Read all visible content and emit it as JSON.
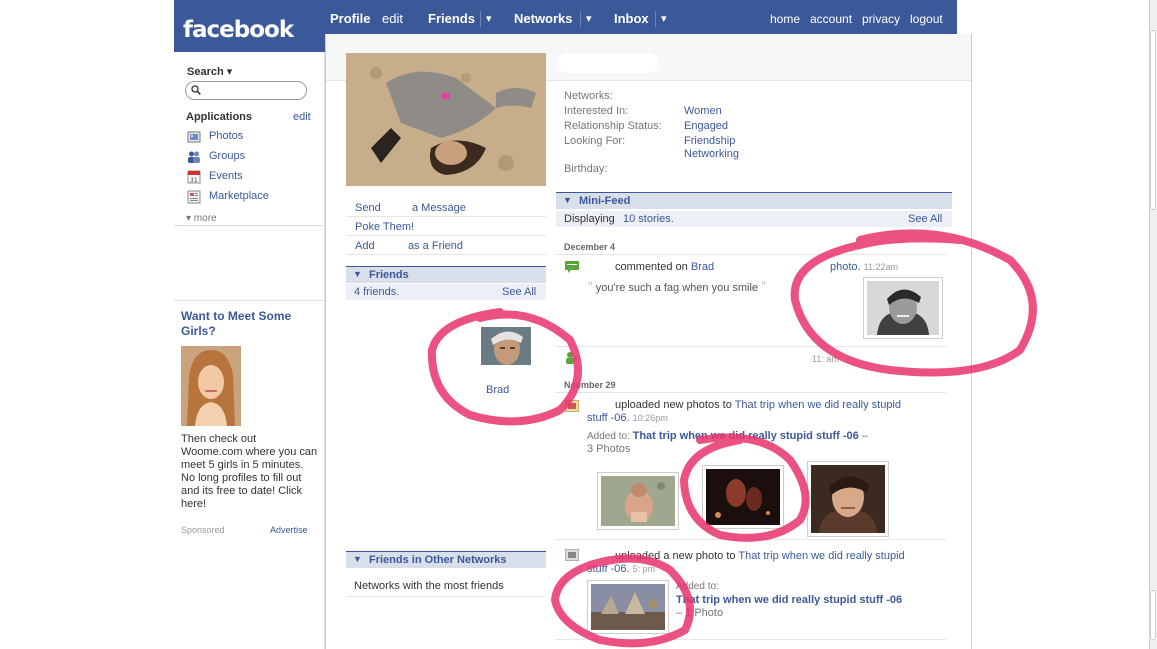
{
  "nav": {
    "logo": "facebook",
    "profile": "Profile",
    "edit": "edit",
    "friends": "Friends",
    "networks": "Networks",
    "inbox": "Inbox",
    "dropdown_glyph": "▾",
    "home": "home",
    "account": "account",
    "privacy": "privacy",
    "logout": "logout"
  },
  "sidebar": {
    "search_label": "Search ▾",
    "applications_title": "Applications",
    "applications_edit": "edit",
    "apps": [
      {
        "label": "Photos",
        "icon": "photos-icon"
      },
      {
        "label": "Groups",
        "icon": "groups-icon"
      },
      {
        "label": "Events",
        "icon": "events-icon"
      },
      {
        "label": "Marketplace",
        "icon": "marketplace-icon"
      }
    ],
    "more": "▾ more",
    "ad": {
      "title": "Want to Meet Some Girls?",
      "text": "Then check out Woome.com where you can meet 5 girls in 5 minutes. No long profiles to fill out and its free to date! Click here!",
      "sponsored": "Sponsored",
      "advertise": "Advertise"
    }
  },
  "profile": {
    "actions": {
      "send": "Send",
      "send_msg": "a Message",
      "poke": "Poke Them!",
      "add": "Add",
      "add_friend": "as a Friend"
    },
    "friends_box": {
      "title": "Friends",
      "count": "4 friends.",
      "see_all": "See All",
      "friend_name": "Brad"
    },
    "other_networks": {
      "title": "Friends in Other Networks",
      "subtitle": "Networks with the most friends"
    }
  },
  "info": {
    "networks_label": "Networks:",
    "interested_label": "Interested In:",
    "interested_value": "Women",
    "relationship_label": "Relationship Status:",
    "relationship_value": "Engaged",
    "looking_label": "Looking For:",
    "looking_value_1": "Friendship",
    "looking_value_2": "Networking",
    "birthday_label": "Birthday:"
  },
  "minifeed": {
    "title": "Mini-Feed",
    "displaying_prefix": "Displaying",
    "displaying_link": "10 stories.",
    "see_all": "See All",
    "date_1": "December 4",
    "story_1_text": "commented on",
    "story_1_link": "Brad",
    "story_1_photo": "photo.",
    "story_1_time": "11:22am",
    "story_1_quote": "you're such a fag when you smile",
    "story_2_time": "11:  am",
    "date_2": "ember 29",
    "date_2_prefix": "No",
    "story_3_text": "uploaded new photos to",
    "story_3_link": "That trip when we did really stupid",
    "story_3_link_2": "stuff -06.",
    "story_3_time": "10:26pm",
    "story_3_added_label": "Added to:",
    "story_3_album": "That trip when we did really stupid stuff -06",
    "story_3_album_dash": " –",
    "story_3_count": "3 Photos",
    "story_4_text": "uploaded a new photo to",
    "story_4_link": "That trip when we did really stupid",
    "story_4_link_2": "stuff -06.",
    "story_4_time": "5:  pm",
    "story_4_added_label": "Added to:",
    "story_4_album": "That trip when we did really stupid stuff -06",
    "story_4_count": "– 1 Photo"
  }
}
